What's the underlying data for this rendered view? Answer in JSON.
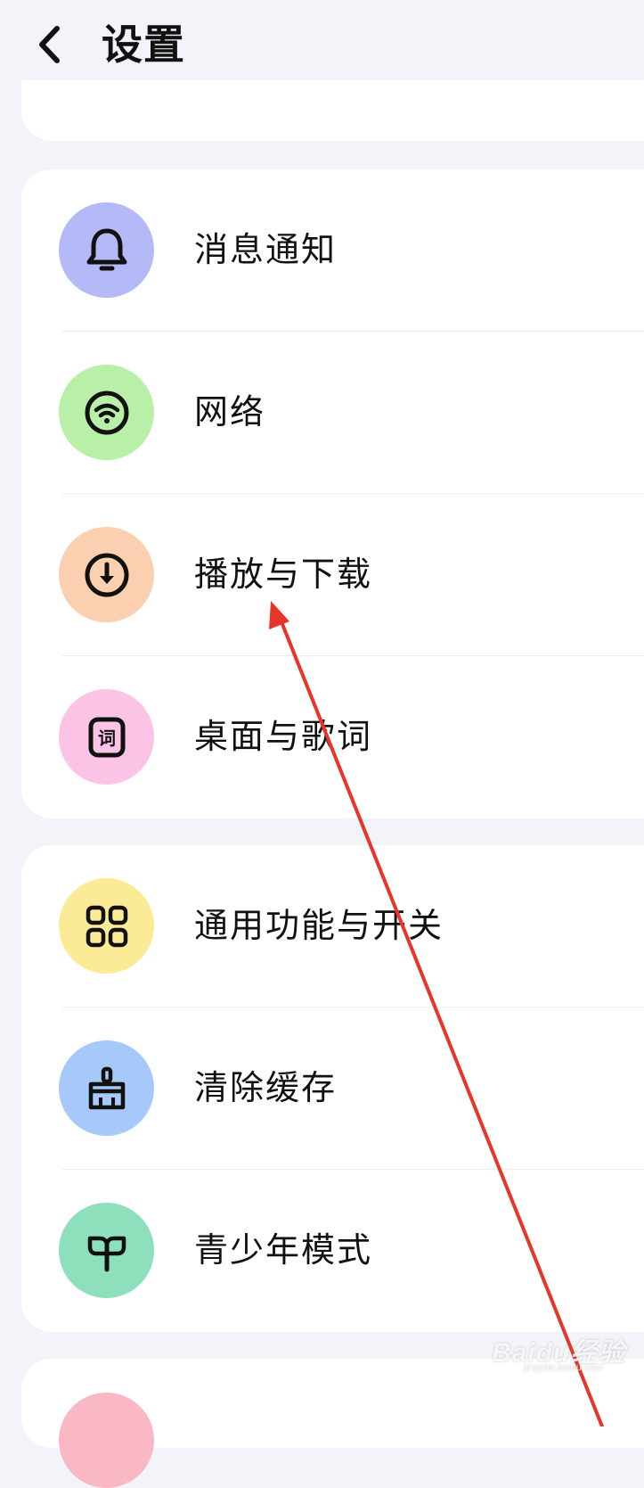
{
  "header": {
    "back_icon": "chevron-left-icon",
    "title": "设置"
  },
  "group1": [
    {
      "label": "消息通知",
      "icon": "bell-icon",
      "color": "#B4B9F7"
    },
    {
      "label": "网络",
      "icon": "wifi-icon",
      "color": "#B9F0A8"
    },
    {
      "label": "播放与下载",
      "icon": "download-icon",
      "color": "#FAD0B0"
    },
    {
      "label": "桌面与歌词",
      "icon": "lyrics-icon",
      "color": "#FBC3E6",
      "icon_text": "词"
    }
  ],
  "group2": [
    {
      "label": "通用功能与开关",
      "icon": "grid-icon",
      "color": "#FCEB96"
    },
    {
      "label": "清除缓存",
      "icon": "broom-icon",
      "color": "#A6C9FA"
    },
    {
      "label": "青少年模式",
      "icon": "sprout-icon",
      "color": "#8EE0BC"
    }
  ],
  "group3_peek_color": "#F9B8C4",
  "annotation_color": "#E8352B",
  "watermark": {
    "brand": "Baidu经验",
    "sub": "jingyan.baidu.com"
  }
}
